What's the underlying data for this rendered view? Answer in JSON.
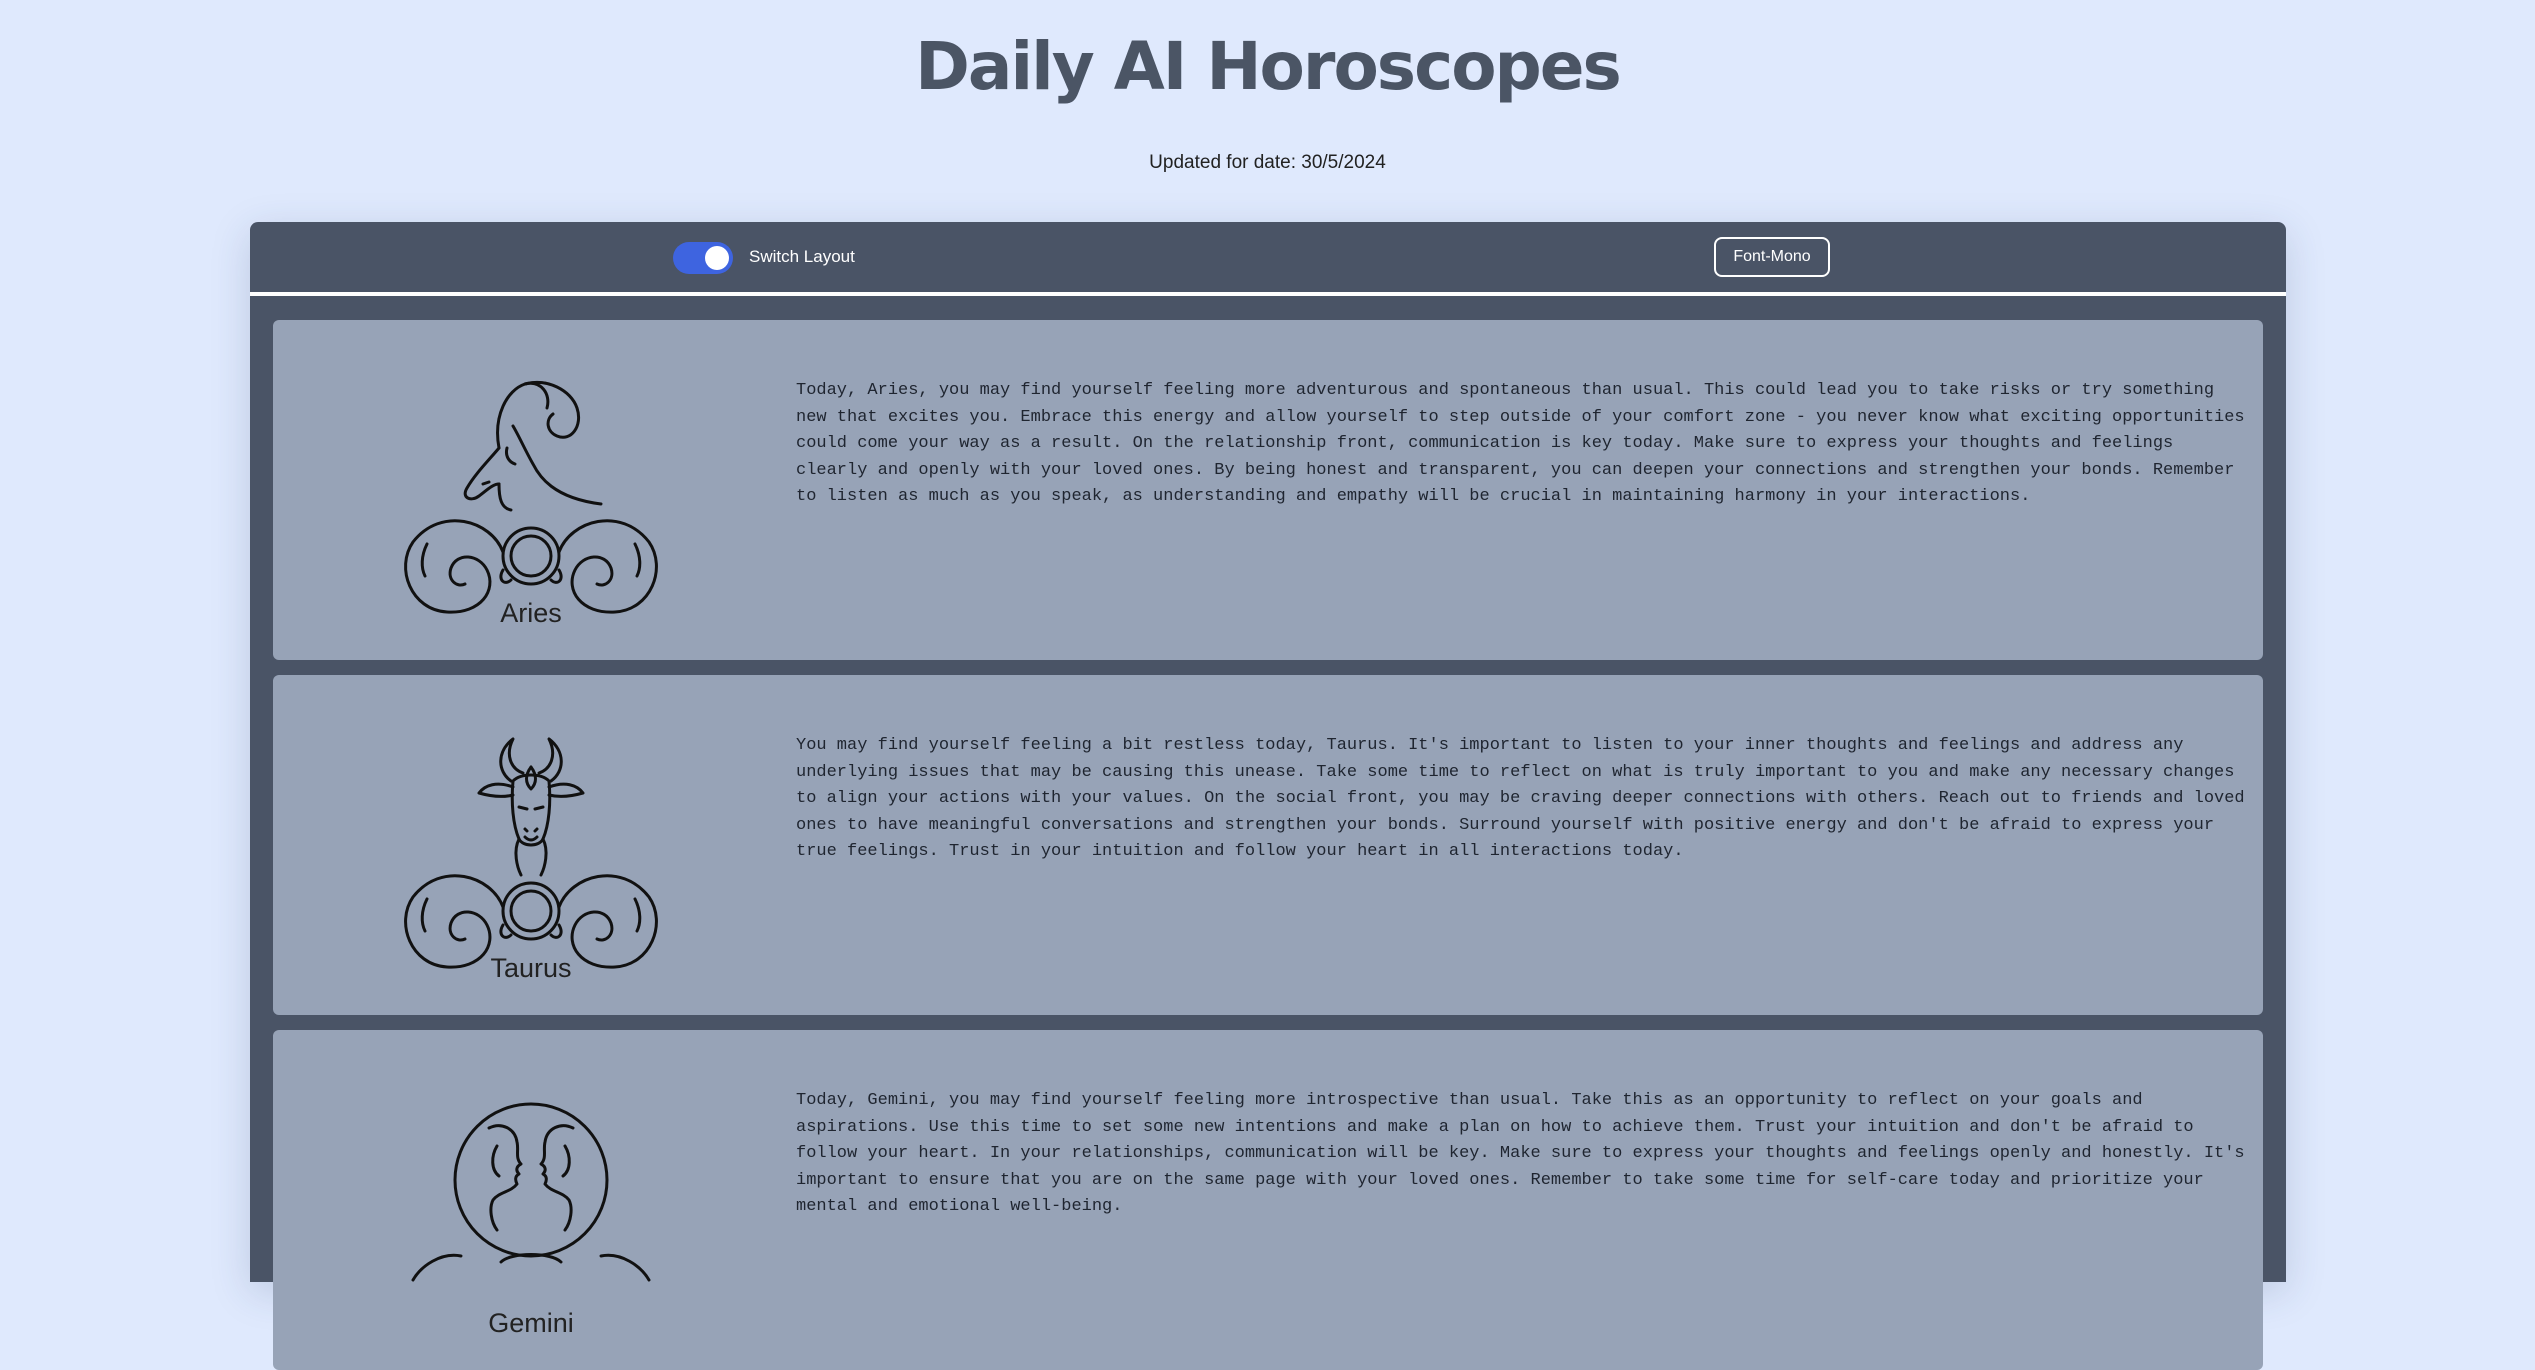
{
  "page": {
    "title": "Daily AI Horoscopes",
    "updated_label": "Updated for date: 30/5/2024"
  },
  "toolbar": {
    "switch_label": "Switch Layout",
    "switch_on": true,
    "font_button_label": "Font-Mono"
  },
  "colors": {
    "background": "#dfe9fd",
    "panel": "#4a5466",
    "card": "#97a3b7",
    "toggle_accent": "#3e64e0",
    "title": "#4b5565"
  },
  "horoscopes": [
    {
      "sign": "Aries",
      "icon": "ram-icon",
      "text": "Today, Aries, you may find yourself feeling more adventurous and spontaneous than usual. This could lead you to take risks or try something new that excites you. Embrace this energy and allow yourself to step outside of your comfort zone - you never know what exciting opportunities could come your way as a result. On the relationship front, communication is key today. Make sure to express your thoughts and feelings clearly and openly with your loved ones. By being honest and transparent, you can deepen your connections and strengthen your bonds. Remember to listen as much as you speak, as understanding and empathy will be crucial in maintaining harmony in your interactions."
    },
    {
      "sign": "Taurus",
      "icon": "bull-icon",
      "text": "You may find yourself feeling a bit restless today, Taurus. It's important to listen to your inner thoughts and feelings and address any underlying issues that may be causing this unease. Take some time to reflect on what is truly important to you and make any necessary changes to align your actions with your values. On the social front, you may be craving deeper connections with others. Reach out to friends and loved ones to have meaningful conversations and strengthen your bonds. Surround yourself with positive energy and don't be afraid to express your true feelings. Trust in your intuition and follow your heart in all interactions today."
    },
    {
      "sign": "Gemini",
      "icon": "twins-icon",
      "text": "Today, Gemini, you may find yourself feeling more introspective than usual. Take this as an opportunity to reflect on your goals and aspirations. Use this time to set some new intentions and make a plan on how to achieve them. Trust your intuition and don't be afraid to follow your heart. In your relationships, communication will be key. Make sure to express your thoughts and feelings openly and honestly. It's important to ensure that you are on the same page with your loved ones. Remember to take some time for self-care today and prioritize your mental and emotional well-being."
    }
  ]
}
